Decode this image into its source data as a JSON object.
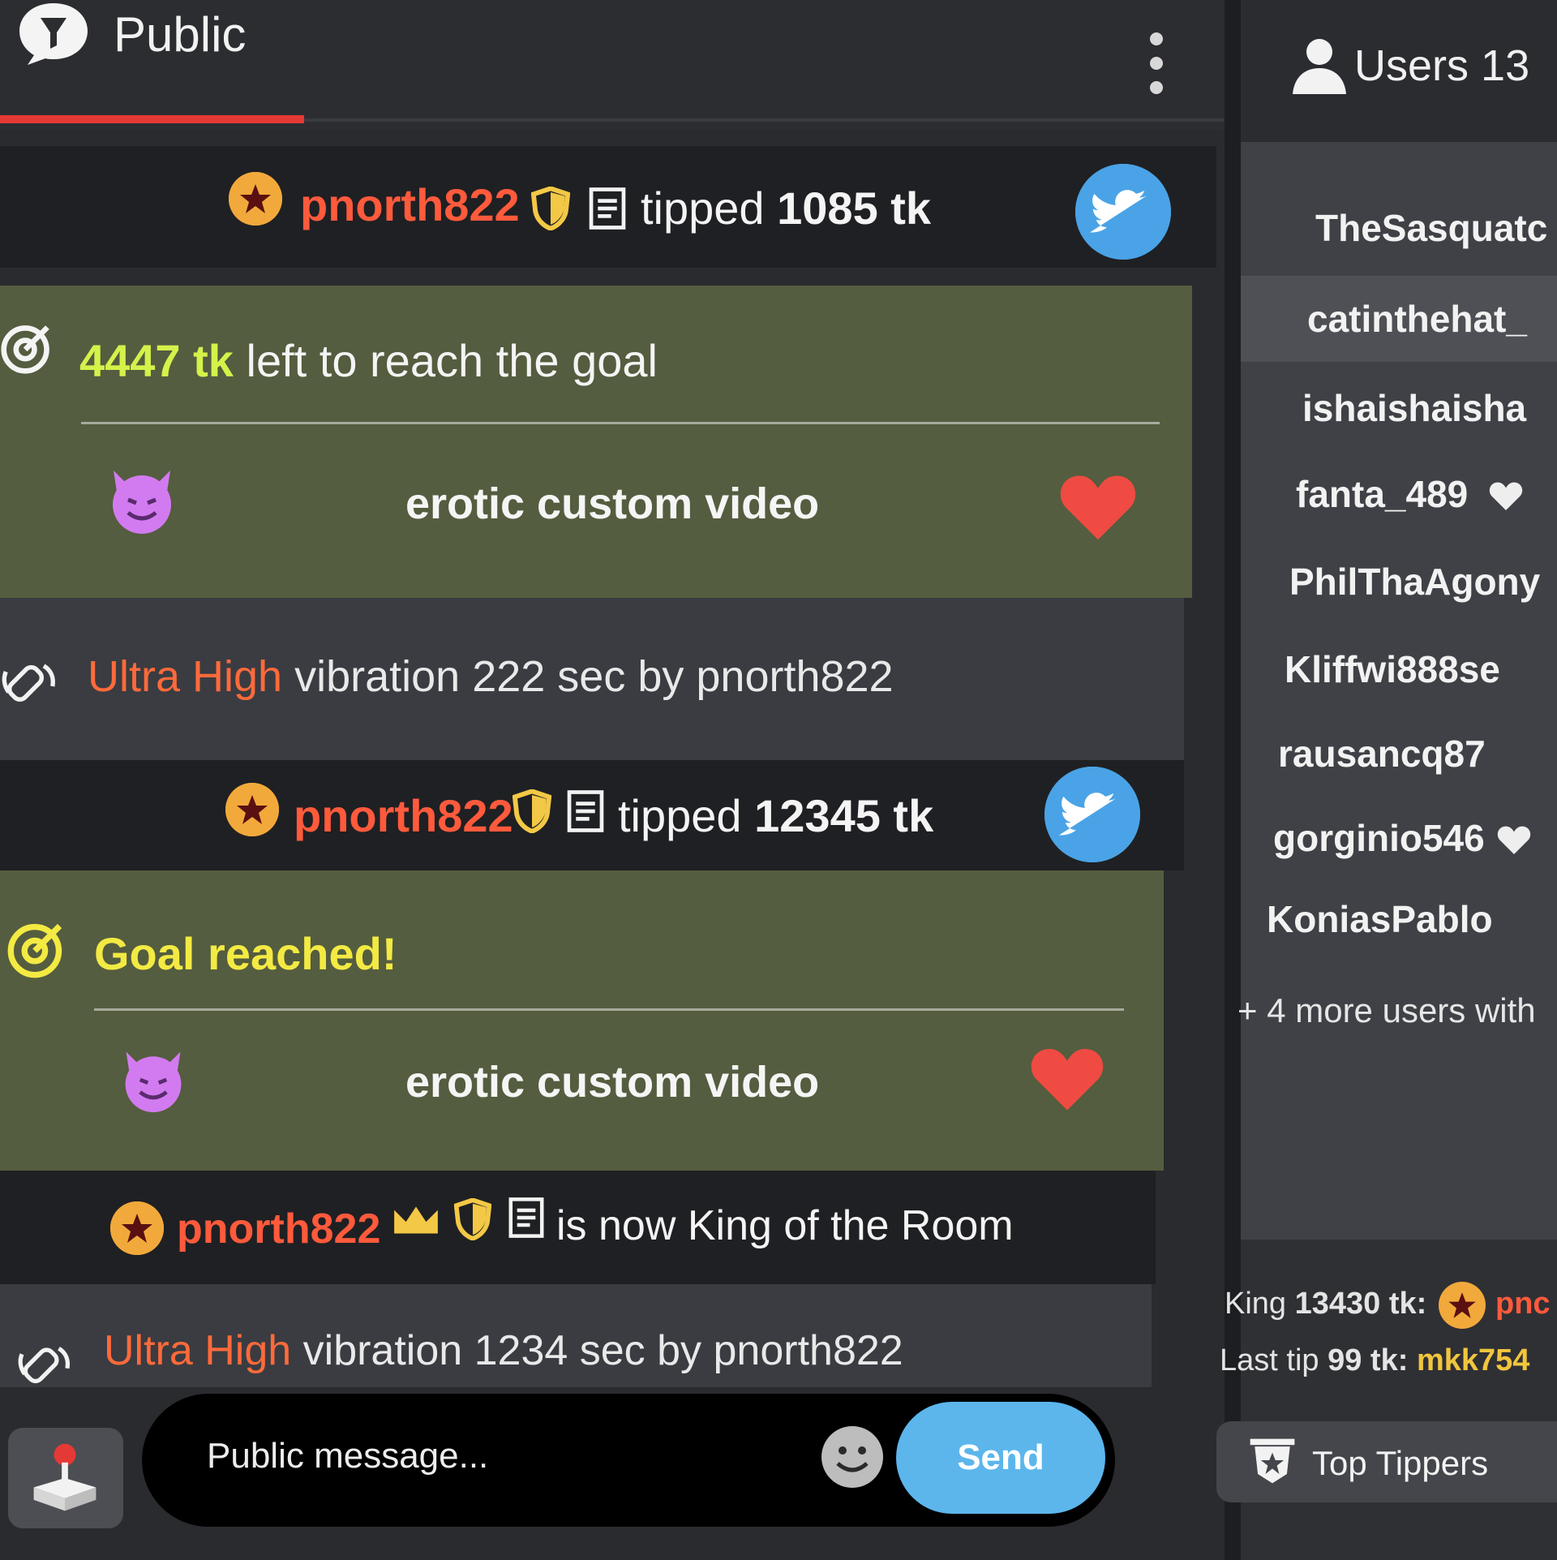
{
  "header": {
    "title": "Public"
  },
  "chat": {
    "messages": [
      {
        "type": "tip",
        "username": "pnorth822",
        "text_prefix": "tipped ",
        "amount": "1085 tk"
      },
      {
        "type": "goal",
        "amount": "4447 tk",
        "text": "left to reach the goal",
        "item": "erotic custom video"
      },
      {
        "type": "vibration",
        "level": "Ultra High",
        "text": "vibration 222 sec by pnorth822"
      },
      {
        "type": "tip",
        "username": "pnorth822",
        "text_prefix": "tipped ",
        "amount": "12345 tk"
      },
      {
        "type": "goal-reached",
        "text": "Goal reached!",
        "item": "erotic custom video"
      },
      {
        "type": "king",
        "username": "pnorth822",
        "text": "is now King of the Room"
      },
      {
        "type": "vibration",
        "level": "Ultra High",
        "text": "vibration 1234 sec by pnorth822"
      }
    ]
  },
  "input": {
    "placeholder": "Public message...",
    "send_label": "Send"
  },
  "users": {
    "title": "Users",
    "count": "13",
    "list": [
      "TheSasquatc",
      "catinthehat_",
      "ishaishaisha",
      "fanta_489",
      "PhilThaAgony",
      "Kliffwi888se",
      "rausancq87",
      "gorginio546",
      "KoniasPablo"
    ],
    "more": "+ 4 more users with"
  },
  "footer": {
    "king_label": "King",
    "king_amount": "13430 tk:",
    "king_user": "pnc",
    "last_tip_label": "Last tip",
    "last_tip_amount": "99 tk:",
    "last_tip_user": "mkk754",
    "top_tippers_label": "Top Tippers"
  },
  "colors": {
    "accent_red": "#e53935",
    "username_red": "#ff5a3c",
    "goal_green": "#d4f24a",
    "goal_yellow": "#f3ea43",
    "twitter_blue": "#4aa3e6",
    "send_blue": "#5cb6ec",
    "last_tip_user": "#f2c53d"
  },
  "icons": {
    "header": "chat-bubble-icon",
    "menu": "kebab-menu-icon",
    "badge": "star-badge-icon",
    "shield": "shield-icon",
    "note": "note-icon",
    "crown": "crown-icon",
    "twitter": "twitter-bird-icon",
    "goal": "target-icon",
    "devil": "smiling-devil-icon",
    "heart": "heart-icon",
    "vibration": "vibration-icon",
    "emoji": "emoji-icon",
    "game": "joystick-icon",
    "user": "user-icon",
    "trophy": "trophy-icon"
  }
}
